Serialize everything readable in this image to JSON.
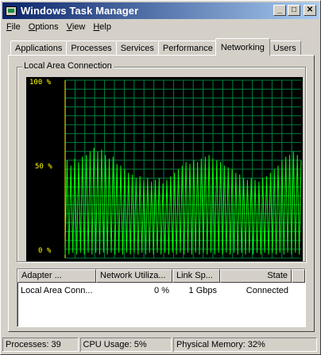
{
  "window": {
    "title": "Windows Task Manager"
  },
  "menu": [
    {
      "label": "File",
      "u": "F",
      "rest": "ile"
    },
    {
      "label": "Options",
      "u": "O",
      "rest": "ptions"
    },
    {
      "label": "View",
      "u": "V",
      "rest": "iew"
    },
    {
      "label": "Help",
      "u": "H",
      "rest": "elp"
    }
  ],
  "tabs": [
    "Applications",
    "Processes",
    "Services",
    "Performance",
    "Networking",
    "Users"
  ],
  "active_tab": "Networking",
  "graph": {
    "title": "Local Area Connection",
    "y_labels": [
      "100 %",
      "50 %",
      "0 %"
    ],
    "grid_color": "#008040",
    "line_color": "#00ff00",
    "marker_color": "#ffff00"
  },
  "chart_data": {
    "type": "line",
    "title": "Local Area Connection",
    "ylim": [
      0,
      100
    ],
    "series": [
      {
        "values": [
          2,
          55,
          2,
          52,
          3,
          56,
          2,
          54,
          3,
          57,
          2,
          58,
          3,
          60,
          2,
          62,
          3,
          60,
          2,
          61,
          3,
          58,
          2,
          56,
          3,
          57,
          2,
          53,
          3,
          52,
          2,
          50,
          3,
          48,
          2,
          47,
          3,
          45,
          2,
          46,
          3,
          44,
          2,
          45,
          3,
          43,
          2,
          44,
          3,
          45,
          2,
          42,
          3,
          44,
          2,
          46,
          3,
          48,
          2,
          50,
          3,
          52,
          2,
          54,
          3,
          53,
          2,
          55,
          3,
          54,
          2,
          56,
          3,
          57,
          2,
          58,
          3,
          56,
          2,
          55,
          3,
          54,
          2,
          52,
          3,
          51,
          2,
          50,
          3,
          48,
          2,
          47,
          3,
          45,
          2,
          44,
          3,
          45,
          2,
          44,
          3,
          43,
          2,
          45,
          3,
          46,
          2,
          48,
          3,
          50,
          2,
          52,
          3,
          55,
          2,
          57,
          3,
          58,
          2,
          60,
          3,
          58,
          2,
          55
        ]
      }
    ]
  },
  "list": {
    "columns": [
      "Adapter ...",
      "Network Utiliza...",
      "Link Sp...",
      "State"
    ],
    "rows": [
      {
        "adapter": "Local Area Conn...",
        "utilization": "0 %",
        "speed": "1 Gbps",
        "state": "Connected"
      }
    ]
  },
  "status": {
    "processes": "Processes: 39",
    "cpu": "CPU Usage: 5%",
    "memory": "Physical Memory: 32%"
  }
}
